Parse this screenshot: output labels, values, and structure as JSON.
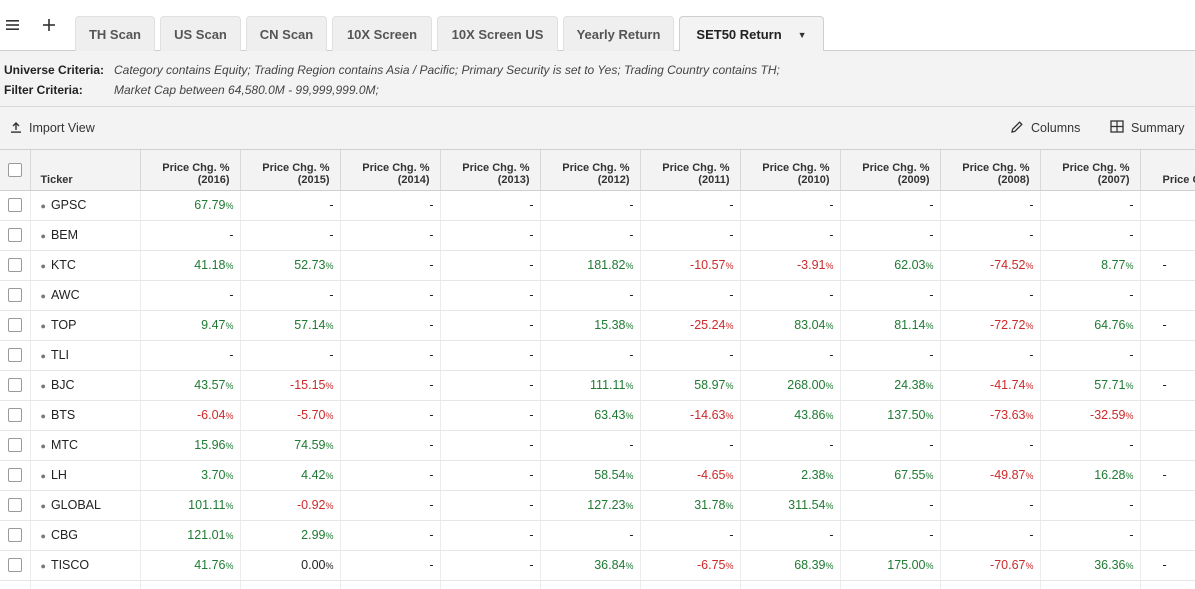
{
  "tabs": [
    "TH Scan",
    "US Scan",
    "CN Scan",
    "10X Screen",
    "10X Screen US",
    "Yearly Return",
    "SET50 Return"
  ],
  "active_tab": "SET50 Return",
  "criteria": {
    "universe_label": "Universe Criteria:",
    "universe_value": "Category contains Equity; Trading Region contains Asia / Pacific; Primary Security is set to Yes; Trading Country contains TH;",
    "filter_label": "Filter Criteria:",
    "filter_value": "Market Cap between 64,580.0M - 99,999,999.0M;"
  },
  "toolbar": {
    "import_label": "Import View",
    "columns_label": "Columns",
    "summary_label": "Summary"
  },
  "table": {
    "ticker_header": "Ticker",
    "headers": [
      [
        "Price Chg. %",
        "(2016)"
      ],
      [
        "Price Chg. %",
        "(2015)"
      ],
      [
        "Price Chg. %",
        "(2014)"
      ],
      [
        "Price Chg. %",
        "(2013)"
      ],
      [
        "Price Chg. %",
        "(2012)"
      ],
      [
        "Price Chg. %",
        "(2011)"
      ],
      [
        "Price Chg. %",
        "(2010)"
      ],
      [
        "Price Chg. %",
        "(2009)"
      ],
      [
        "Price Chg. %",
        "(2008)"
      ],
      [
        "Price Chg. %",
        "(2007)"
      ],
      [
        "Price C",
        ""
      ]
    ],
    "rows": [
      {
        "ticker": "GPSC",
        "values": [
          "67.79",
          "-",
          "-",
          "-",
          "-",
          "-",
          "-",
          "-",
          "-",
          "-",
          ""
        ]
      },
      {
        "ticker": "BEM",
        "values": [
          "-",
          "-",
          "-",
          "-",
          "-",
          "-",
          "-",
          "-",
          "-",
          "-",
          ""
        ]
      },
      {
        "ticker": "KTC",
        "values": [
          "41.18",
          "52.73",
          "-",
          "-",
          "181.82",
          "-10.57",
          "-3.91",
          "62.03",
          "-74.52",
          "8.77",
          "-"
        ]
      },
      {
        "ticker": "AWC",
        "values": [
          "-",
          "-",
          "-",
          "-",
          "-",
          "-",
          "-",
          "-",
          "-",
          "-",
          ""
        ]
      },
      {
        "ticker": "TOP",
        "values": [
          "9.47",
          "57.14",
          "-",
          "-",
          "15.38",
          "-25.24",
          "83.04",
          "81.14",
          "-72.72",
          "64.76",
          "-"
        ]
      },
      {
        "ticker": "TLI",
        "values": [
          "-",
          "-",
          "-",
          "-",
          "-",
          "-",
          "-",
          "-",
          "-",
          "-",
          ""
        ]
      },
      {
        "ticker": "BJC",
        "values": [
          "43.57",
          "-15.15",
          "-",
          "-",
          "111.11",
          "58.97",
          "268.00",
          "24.38",
          "-41.74",
          "57.71",
          "-"
        ]
      },
      {
        "ticker": "BTS",
        "values": [
          "-6.04",
          "-5.70",
          "-",
          "-",
          "63.43",
          "-14.63",
          "43.86",
          "137.50",
          "-73.63",
          "-32.59",
          ""
        ]
      },
      {
        "ticker": "MTC",
        "values": [
          "15.96",
          "74.59",
          "-",
          "-",
          "-",
          "-",
          "-",
          "-",
          "-",
          "-",
          ""
        ]
      },
      {
        "ticker": "LH",
        "values": [
          "3.70",
          "4.42",
          "-",
          "-",
          "58.54",
          "-4.65",
          "2.38",
          "67.55",
          "-49.87",
          "16.28",
          "-"
        ]
      },
      {
        "ticker": "GLOBAL",
        "values": [
          "101.11",
          "-0.92",
          "-",
          "-",
          "127.23",
          "31.78",
          "311.54",
          "-",
          "-",
          "-",
          ""
        ]
      },
      {
        "ticker": "CBG",
        "values": [
          "121.01",
          "2.99",
          "-",
          "-",
          "-",
          "-",
          "-",
          "-",
          "-",
          "-",
          ""
        ]
      },
      {
        "ticker": "TISCO",
        "values": [
          "41.76",
          "0.00",
          "-",
          "-",
          "36.84",
          "-6.75",
          "68.39",
          "175.00",
          "-70.67",
          "36.36",
          "-"
        ]
      },
      {
        "ticker": "",
        "values": [
          "",
          "",
          "",
          "",
          "",
          "",
          "",
          "",
          "",
          "",
          ""
        ]
      }
    ]
  },
  "colors": {
    "positive": "#1f7a33",
    "negative": "#cc2a2a"
  }
}
